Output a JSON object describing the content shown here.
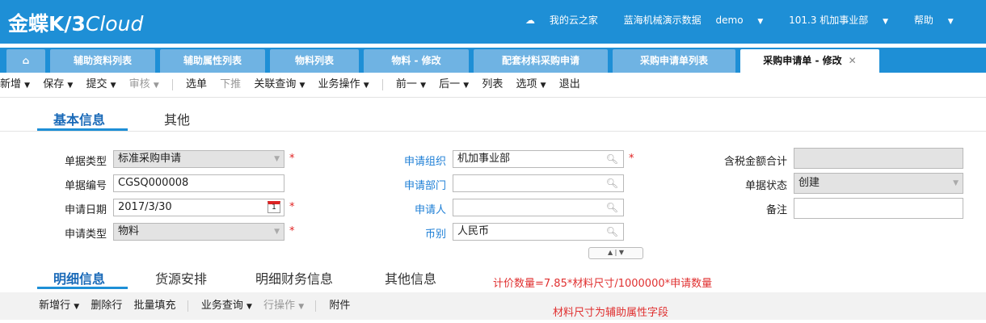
{
  "header": {
    "logo_text": "金蝶K/3",
    "logo_cloud": "Cloud",
    "nav": {
      "my_cloud": "我的云之家",
      "dataset": "蓝海机械演示数据",
      "user": "demo",
      "org": "101.3  机加事业部",
      "help": "帮助"
    }
  },
  "tabs": [
    "辅助资料列表",
    "辅助属性列表",
    "物料列表",
    "物料 - 修改",
    "配套材料采购申请",
    "采购申请单列表",
    "采购申请单 - 修改"
  ],
  "toolbar": {
    "new": "新增",
    "save": "保存",
    "submit": "提交",
    "audit": "审核",
    "select_doc": "选单",
    "push_down": "下推",
    "related_query": "关联查询",
    "business_ops": "业务操作",
    "prev": "前一",
    "next": "后一",
    "list": "列表",
    "options": "选项",
    "exit": "退出"
  },
  "form_tabs": {
    "basic": "基本信息",
    "other": "其他"
  },
  "fields": {
    "doc_type": {
      "label": "单据类型",
      "value": "标准采购申请"
    },
    "doc_no": {
      "label": "单据编号",
      "value": "CGSQ000008"
    },
    "apply_date": {
      "label": "申请日期",
      "value": "2017/3/30",
      "cal_day": "1"
    },
    "apply_type": {
      "label": "申请类型",
      "value": "物料"
    },
    "apply_org": {
      "label": "申请组织",
      "value": "机加事业部"
    },
    "apply_dept": {
      "label": "申请部门",
      "value": ""
    },
    "applicant": {
      "label": "申请人",
      "value": ""
    },
    "currency": {
      "label": "币别",
      "value": "人民币"
    },
    "tax_total": {
      "label": "含税金额合计",
      "value": ""
    },
    "doc_status": {
      "label": "单据状态",
      "value": "创建"
    },
    "remark": {
      "label": "备注",
      "value": ""
    }
  },
  "required_mark": "*",
  "detail_tabs": {
    "detail": "明细信息",
    "source": "货源安排",
    "finance": "明细财务信息",
    "other": "其他信息"
  },
  "notes": {
    "price_formula": "计价数量=7.85*材料尺寸/1000000*申请数量",
    "size_note": "材料尺寸为辅助属性字段"
  },
  "detail_toolbar": {
    "add_row": "新增行",
    "delete_row": "删除行",
    "batch_fill": "批量填充",
    "business_query": "业务查询",
    "row_ops": "行操作",
    "attachment": "附件"
  },
  "colors": {
    "header_blue": "#1e8fd6",
    "label_blue": "#1e7fd6",
    "note_red": "#e03030"
  }
}
